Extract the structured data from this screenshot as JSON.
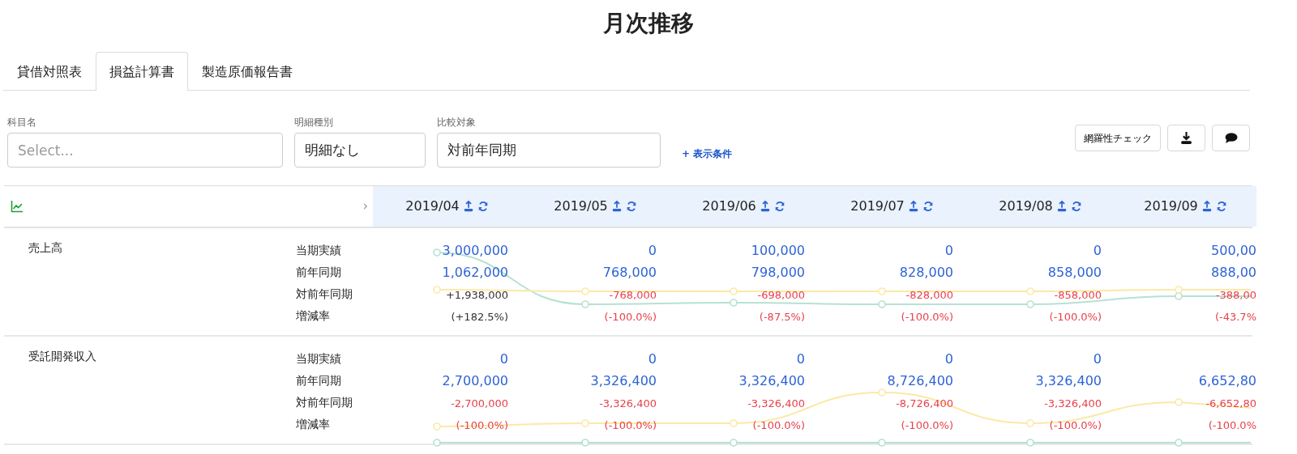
{
  "title": "月次推移",
  "tabs": [
    {
      "label": "貸借対照表",
      "selected": false
    },
    {
      "label": "損益計算書",
      "selected": true
    },
    {
      "label": "製造原価報告書",
      "selected": false
    }
  ],
  "filters": [
    {
      "label": "科目名",
      "placeholder": "Select..."
    },
    {
      "label": "明細種別",
      "value": "明細なし"
    },
    {
      "label": "比較対象",
      "value": "対前年同期"
    }
  ],
  "conditions_link": {
    "icon": "+",
    "label": "表示条件"
  },
  "check_button": "網羅性チェック",
  "months": [
    "2019/04",
    "2019/05",
    "2019/06",
    "2019/07",
    "2019/08",
    "2019/09"
  ],
  "accounts": [
    {
      "name": "売上高",
      "rows": [
        {
          "label": "当期実績",
          "kind": "amount",
          "values": [
            {
              "text": "3,000,000",
              "color": "#2e63d6"
            },
            {
              "text": "0",
              "color": "#2e63d6"
            },
            {
              "text": "100,000",
              "color": "#2e63d6"
            },
            {
              "text": "0",
              "color": "#2e63d6"
            },
            {
              "text": "0",
              "color": "#2e63d6"
            },
            {
              "text": "500,00",
              "color": "#2e63d6"
            }
          ]
        },
        {
          "label": "前年同期",
          "kind": "amount",
          "values": [
            {
              "text": "1,062,000",
              "color": "#2e63d6"
            },
            {
              "text": "768,000",
              "color": "#2e63d6"
            },
            {
              "text": "798,000",
              "color": "#2e63d6"
            },
            {
              "text": "828,000",
              "color": "#2e63d6"
            },
            {
              "text": "858,000",
              "color": "#2e63d6"
            },
            {
              "text": "888,00",
              "color": "#2e63d6"
            }
          ]
        },
        {
          "label": "対前年同期",
          "kind": "change",
          "values": [
            {
              "text": "+1,938,000",
              "color": "#333333"
            },
            {
              "text": "-768,000",
              "color": "#e8414b"
            },
            {
              "text": "-698,000",
              "color": "#e8414b"
            },
            {
              "text": "-828,000",
              "color": "#e8414b"
            },
            {
              "text": "-858,000",
              "color": "#e8414b"
            },
            {
              "text": "-388,00",
              "color": "#e8414b"
            }
          ]
        },
        {
          "label": "増減率",
          "kind": "change",
          "values": [
            {
              "text": "(+182.5%)",
              "color": "#333333"
            },
            {
              "text": "(-100.0%)",
              "color": "#e8414b"
            },
            {
              "text": "(-87.5%)",
              "color": "#e8414b"
            },
            {
              "text": "(-100.0%)",
              "color": "#e8414b"
            },
            {
              "text": "(-100.0%)",
              "color": "#e8414b"
            },
            {
              "text": "(-43.7%",
              "color": "#e8414b"
            }
          ]
        }
      ]
    },
    {
      "name": "受託開発収入",
      "rows": [
        {
          "label": "当期実績",
          "kind": "amount",
          "values": [
            {
              "text": "0",
              "color": "#2e63d6"
            },
            {
              "text": "0",
              "color": "#2e63d6"
            },
            {
              "text": "0",
              "color": "#2e63d6"
            },
            {
              "text": "0",
              "color": "#2e63d6"
            },
            {
              "text": "0",
              "color": "#2e63d6"
            }
          ]
        },
        {
          "label": "前年同期",
          "kind": "amount",
          "values": [
            {
              "text": "2,700,000",
              "color": "#2e63d6"
            },
            {
              "text": "3,326,400",
              "color": "#2e63d6"
            },
            {
              "text": "3,326,400",
              "color": "#2e63d6"
            },
            {
              "text": "8,726,400",
              "color": "#2e63d6"
            },
            {
              "text": "3,326,400",
              "color": "#2e63d6"
            },
            {
              "text": "6,652,80",
              "color": "#2e63d6"
            }
          ]
        },
        {
          "label": "対前年同期",
          "kind": "change",
          "values": [
            {
              "text": "-2,700,000",
              "color": "#e8414b"
            },
            {
              "text": "-3,326,400",
              "color": "#e8414b"
            },
            {
              "text": "-3,326,400",
              "color": "#e8414b"
            },
            {
              "text": "-8,726,400",
              "color": "#e8414b"
            },
            {
              "text": "-3,326,400",
              "color": "#e8414b"
            },
            {
              "text": "-6,652,80",
              "color": "#e8414b"
            }
          ]
        },
        {
          "label": "増減率",
          "kind": "change",
          "values": [
            {
              "text": "(-100.0%)",
              "color": "#e8414b"
            },
            {
              "text": "(-100.0%)",
              "color": "#e8414b"
            },
            {
              "text": "(-100.0%)",
              "color": "#e8414b"
            },
            {
              "text": "(-100.0%)",
              "color": "#e8414b"
            },
            {
              "text": "(-100.0%)",
              "color": "#e8414b"
            },
            {
              "text": "(-100.0%",
              "color": "#e8414b"
            }
          ]
        }
      ]
    }
  ]
}
